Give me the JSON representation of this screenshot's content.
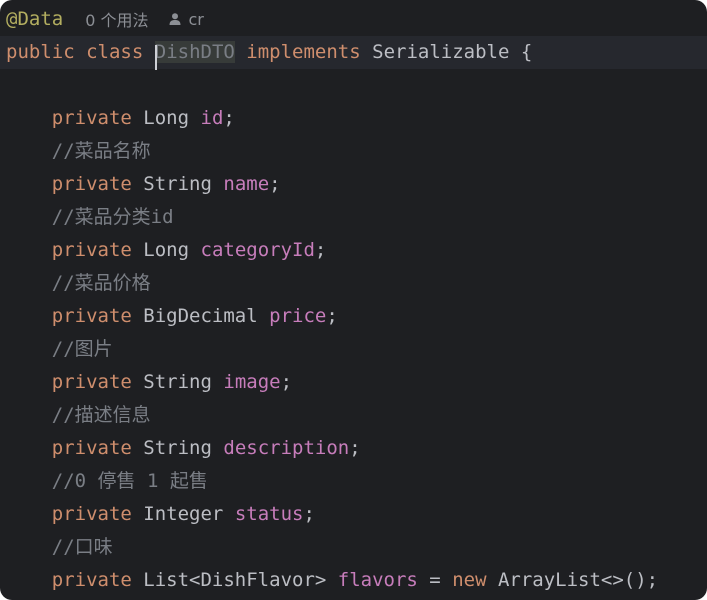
{
  "hint": {
    "annotation": "@Data",
    "usages": "0 个用法",
    "author": "cr"
  },
  "class_decl": {
    "public": "public",
    "class": "class",
    "name": "DishDTO",
    "implements": "implements",
    "interface": "Serializable",
    "brace": " {"
  },
  "fields": [
    {
      "comment": "",
      "mod": "private",
      "type": "Long",
      "name": "id",
      "tail": ";"
    },
    {
      "comment": "//菜品名称",
      "mod": "private",
      "type": "String",
      "name": "name",
      "tail": ";"
    },
    {
      "comment": "//菜品分类id",
      "mod": "private",
      "type": "Long",
      "name": "categoryId",
      "tail": ";"
    },
    {
      "comment": "//菜品价格",
      "mod": "private",
      "type": "BigDecimal",
      "name": "price",
      "tail": ";"
    },
    {
      "comment": "//图片",
      "mod": "private",
      "type": "String",
      "name": "image",
      "tail": ";"
    },
    {
      "comment": "//描述信息",
      "mod": "private",
      "type": "String",
      "name": "description",
      "tail": ";"
    },
    {
      "comment": "//0 停售 1 起售",
      "mod": "private",
      "type": "Integer",
      "name": "status",
      "tail": ";"
    },
    {
      "comment": "//口味",
      "mod": "private",
      "type": "List<DishFlavor>",
      "name": "flavors",
      "assign": " = ",
      "new_kw": "new",
      "init": " ArrayList<>();"
    }
  ],
  "colors": {
    "background": "#1e1f22",
    "keyword": "#cf8e6d",
    "field": "#c77dbb",
    "comment": "#7a7e85",
    "annotation": "#b3ae60",
    "text": "#bcbec4"
  }
}
